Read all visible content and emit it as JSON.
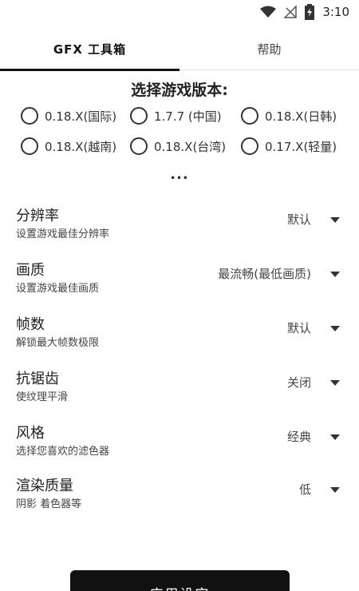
{
  "status_bar": {
    "time": "3:10",
    "icons": [
      "wifi-icon",
      "no-signal-icon",
      "battery-charging-icon"
    ]
  },
  "tabs": [
    {
      "label": "GFX 工具箱",
      "active": true
    },
    {
      "label": "帮助",
      "active": false
    }
  ],
  "version_section": {
    "title": "选择游戏版本:",
    "options": [
      {
        "label": "0.18.X(国际)"
      },
      {
        "label": "1.7.7 (中国)"
      },
      {
        "label": "0.18.X(日韩)"
      },
      {
        "label": "0.18.X(越南)"
      },
      {
        "label": "0.18.X(台湾)"
      },
      {
        "label": "0.17.X(轻量)"
      }
    ],
    "more": "..."
  },
  "settings": [
    {
      "title": "分辨率",
      "desc": "设置游戏最佳分辨率",
      "value": "默认"
    },
    {
      "title": "画质",
      "desc": "设置游戏最佳画质",
      "value": "最流畅(最低画质)"
    },
    {
      "title": "帧数",
      "desc": "解锁最大帧数极限",
      "value": "默认"
    },
    {
      "title": "抗锯齿",
      "desc": "使纹理平滑",
      "value": "关闭"
    },
    {
      "title": "风格",
      "desc": "选择您喜欢的滤色器",
      "value": "经典"
    },
    {
      "title": "渲染质量",
      "desc": "阴影 着色器等",
      "value": "低"
    }
  ],
  "apply_button": {
    "label": "应用设定"
  }
}
